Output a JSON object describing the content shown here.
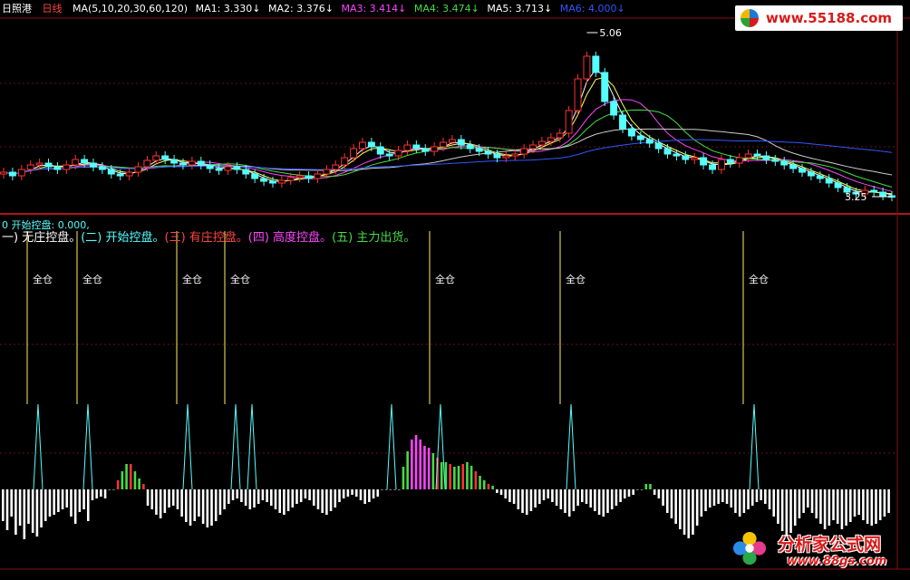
{
  "header": {
    "stock": "日照港",
    "period": "日线",
    "ma_set": "MA(5,10,20,30,60,120)",
    "ma_labels": [
      {
        "text": "MA1: 3.330↓",
        "color": "#ffffff"
      },
      {
        "text": "MA2: 3.376↓",
        "color": "#ffffff"
      },
      {
        "text": "MA3: 3.414↓",
        "color": "#ff44ff"
      },
      {
        "text": "MA4: 3.474↓",
        "color": "#44dd44"
      },
      {
        "text": "MA5: 3.713↓",
        "color": "#ffffff"
      },
      {
        "text": "MA6: 4.000↓",
        "color": "#3355ff"
      }
    ]
  },
  "indicator": {
    "line0": "0 开始控盘: 0.000,",
    "stages": [
      {
        "text": "一) 无庄控盘。",
        "color": "#ffffff"
      },
      {
        "text": "(二) 开始控盘。",
        "color": "#55ffff"
      },
      {
        "text": "(三) 有庄控盘。",
        "color": "#ff4444"
      },
      {
        "text": "(四) 高度控盘。",
        "color": "#ff44ff"
      },
      {
        "text": "(五) 主力出货。",
        "color": "#44dd44"
      }
    ],
    "signal_label": "全仓"
  },
  "brand": {
    "top": "www.55188.com",
    "bottom_cn": "分析家公式网",
    "bottom_url": "www.88gs.com"
  },
  "chart_data": [
    {
      "type": "candlestick",
      "title": "日照港 日线",
      "annotations": [
        {
          "label": "5.06",
          "kind": "high"
        },
        {
          "label": "3.25",
          "kind": "low"
        }
      ],
      "price": {
        "close": [
          3.52,
          3.48,
          3.55,
          3.6,
          3.62,
          3.58,
          3.55,
          3.6,
          3.66,
          3.62,
          3.58,
          3.55,
          3.5,
          3.48,
          3.52,
          3.58,
          3.65,
          3.7,
          3.66,
          3.62,
          3.6,
          3.64,
          3.6,
          3.56,
          3.54,
          3.58,
          3.55,
          3.5,
          3.45,
          3.42,
          3.4,
          3.43,
          3.46,
          3.48,
          3.45,
          3.5,
          3.55,
          3.6,
          3.68,
          3.78,
          3.85,
          3.8,
          3.72,
          3.7,
          3.76,
          3.82,
          3.78,
          3.75,
          3.8,
          3.85,
          3.88,
          3.82,
          3.78,
          3.75,
          3.72,
          3.68,
          3.7,
          3.72,
          3.78,
          3.82,
          3.86,
          3.9,
          3.95,
          4.2,
          4.55,
          4.8,
          4.62,
          4.3,
          4.15,
          4.0,
          3.92,
          3.88,
          3.84,
          3.78,
          3.72,
          3.7,
          3.66,
          3.68,
          3.6,
          3.55,
          3.66,
          3.62,
          3.68,
          3.72,
          3.7,
          3.66,
          3.64,
          3.6,
          3.56,
          3.52,
          3.48,
          3.45,
          3.4,
          3.35,
          3.3,
          3.28,
          3.32,
          3.3,
          3.26,
          3.25
        ],
        "open": [
          3.5,
          3.52,
          3.48,
          3.55,
          3.6,
          3.62,
          3.58,
          3.55,
          3.6,
          3.66,
          3.62,
          3.58,
          3.55,
          3.5,
          3.48,
          3.52,
          3.58,
          3.65,
          3.7,
          3.66,
          3.62,
          3.6,
          3.64,
          3.6,
          3.56,
          3.54,
          3.58,
          3.55,
          3.5,
          3.45,
          3.42,
          3.4,
          3.43,
          3.46,
          3.48,
          3.45,
          3.5,
          3.55,
          3.6,
          3.68,
          3.78,
          3.85,
          3.8,
          3.72,
          3.7,
          3.76,
          3.82,
          3.78,
          3.75,
          3.8,
          3.85,
          3.88,
          3.82,
          3.78,
          3.75,
          3.72,
          3.68,
          3.7,
          3.72,
          3.78,
          3.82,
          3.86,
          3.9,
          3.95,
          4.2,
          4.55,
          4.8,
          4.62,
          4.3,
          4.15,
          4.0,
          3.92,
          3.88,
          3.84,
          3.78,
          3.72,
          3.7,
          3.66,
          3.68,
          3.6,
          3.55,
          3.66,
          3.62,
          3.68,
          3.72,
          3.7,
          3.66,
          3.64,
          3.6,
          3.56,
          3.52,
          3.48,
          3.45,
          3.4,
          3.35,
          3.3,
          3.28,
          3.32,
          3.3,
          3.26
        ]
      },
      "ylim": [
        3.1,
        5.2
      ]
    },
    {
      "type": "bar",
      "title": "主力控盘",
      "signals": [
        30,
        85,
        195,
        248,
        474,
        618,
        820
      ],
      "values": [
        -35,
        -45,
        -30,
        -50,
        -40,
        -55,
        -38,
        -48,
        -52,
        -42,
        -35,
        -30,
        -28,
        -25,
        -22,
        -20,
        -30,
        -38,
        -25,
        -22,
        -35,
        -12,
        -10,
        -8,
        -10,
        0,
        0,
        10,
        20,
        28,
        28,
        20,
        12,
        6,
        -18,
        -22,
        -28,
        -32,
        -26,
        -20,
        -18,
        -22,
        -30,
        -36,
        -40,
        -35,
        -30,
        -38,
        -42,
        -40,
        -35,
        -28,
        -22,
        -16,
        -12,
        -10,
        -14,
        -18,
        -22,
        -20,
        -16,
        -12,
        -14,
        -18,
        -22,
        -26,
        -28,
        -24,
        -20,
        -16,
        -14,
        -10,
        -12,
        -18,
        -22,
        -26,
        -28,
        -24,
        -20,
        -14,
        -10,
        -8,
        -6,
        -8,
        -12,
        -16,
        -14,
        -10,
        -8,
        0,
        0,
        0,
        0,
        0,
        25,
        42,
        55,
        60,
        55,
        48,
        46,
        40,
        35,
        30,
        30,
        28,
        25,
        26,
        28,
        30,
        26,
        20,
        15,
        10,
        6,
        4,
        -4,
        -6,
        -10,
        -14,
        -16,
        -22,
        -26,
        -28,
        -24,
        -20,
        -16,
        -12,
        -10,
        -14,
        -18,
        -22,
        -26,
        -30,
        -24,
        -18,
        -14,
        -16,
        -20,
        -24,
        -28,
        -30,
        -26,
        -22,
        -18,
        -14,
        -10,
        -8,
        -6,
        0,
        0,
        6,
        6,
        -6,
        -10,
        -18,
        -26,
        -32,
        -38,
        -44,
        -50,
        -54,
        -50,
        -40,
        -30,
        -24,
        -20,
        -18,
        -16,
        -14,
        -16,
        -20,
        -26,
        -30,
        -26,
        -22,
        -18,
        -14,
        -12,
        -16,
        -22,
        -30,
        -38,
        -46,
        -52,
        -48,
        -40,
        -32,
        -26,
        -20,
        -26,
        -32,
        -38,
        -44,
        -40,
        -34,
        -38,
        -44,
        -40,
        -36,
        -30,
        -28,
        -34,
        -38,
        -40,
        -38,
        -34,
        -30,
        -26
      ],
      "ylim": [
        -60,
        100
      ]
    }
  ]
}
